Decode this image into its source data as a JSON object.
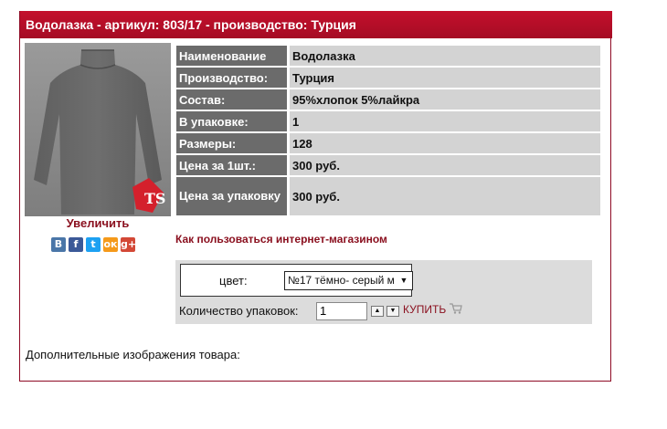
{
  "title": "Водолазка - артикул: 803/17 - производство: Турция",
  "product_image": {
    "alt_semantic": "gray-turtleneck",
    "badge": "TS"
  },
  "enlarge_label": "Увеличить",
  "social": [
    {
      "name": "vk-icon",
      "label": "В",
      "color": "#4a76a8"
    },
    {
      "name": "facebook-icon",
      "label": "f",
      "color": "#3b5998"
    },
    {
      "name": "twitter-icon",
      "label": "t",
      "color": "#1da1f2"
    },
    {
      "name": "odnoklassniki-icon",
      "label": "ок",
      "color": "#f59a1a"
    },
    {
      "name": "googleplus-icon",
      "label": "g+",
      "color": "#d34836"
    }
  ],
  "props": [
    {
      "key": "Наименование",
      "value": "Водолазка"
    },
    {
      "key": "Производство:",
      "value": "Турция"
    },
    {
      "key": "Состав:",
      "value": "95%хлопок 5%лайкра"
    },
    {
      "key": "В упаковке:",
      "value": "1"
    },
    {
      "key": "Размеры:",
      "value": "128"
    },
    {
      "key": "Цена за 1шт.:",
      "value": "300 руб."
    },
    {
      "key": "Цена за упаковку",
      "value": "300 руб."
    }
  ],
  "howto_link": "Как пользоваться интернет-магазином",
  "order": {
    "color_label": "цвет:",
    "color_selected": "№17 тёмно- серый м",
    "qty_label": "Количество упаковок:",
    "qty_value": "1",
    "buy_label": "КУПИТЬ"
  },
  "extra_images_label": "Дополнительные изображения товара:"
}
